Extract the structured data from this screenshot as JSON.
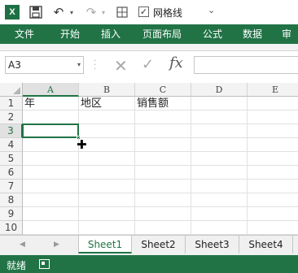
{
  "qat": {
    "logo_text": "X",
    "gridlines_checkbox": "✓",
    "gridlines_label": "网格线",
    "more_icon": "⌄"
  },
  "ribbon": {
    "tabs": [
      "文件",
      "开始",
      "插入",
      "页面布局",
      "公式",
      "数据",
      "审阅"
    ]
  },
  "formula_bar": {
    "name_box": "A3",
    "fx": "fx"
  },
  "grid": {
    "columns": [
      "A",
      "B",
      "C",
      "D",
      "E"
    ],
    "rows": [
      "1",
      "2",
      "3",
      "4",
      "5",
      "6",
      "7",
      "8",
      "9",
      "10"
    ],
    "cells": {
      "A1": "年",
      "B1": "地区",
      "C1": "销售额"
    },
    "selected_cell": "A3"
  },
  "sheets": [
    "Sheet1",
    "Sheet2",
    "Sheet3",
    "Sheet4"
  ],
  "active_sheet": "Sheet1",
  "status": {
    "text": "就绪"
  },
  "colors": {
    "accent": "#217346"
  }
}
